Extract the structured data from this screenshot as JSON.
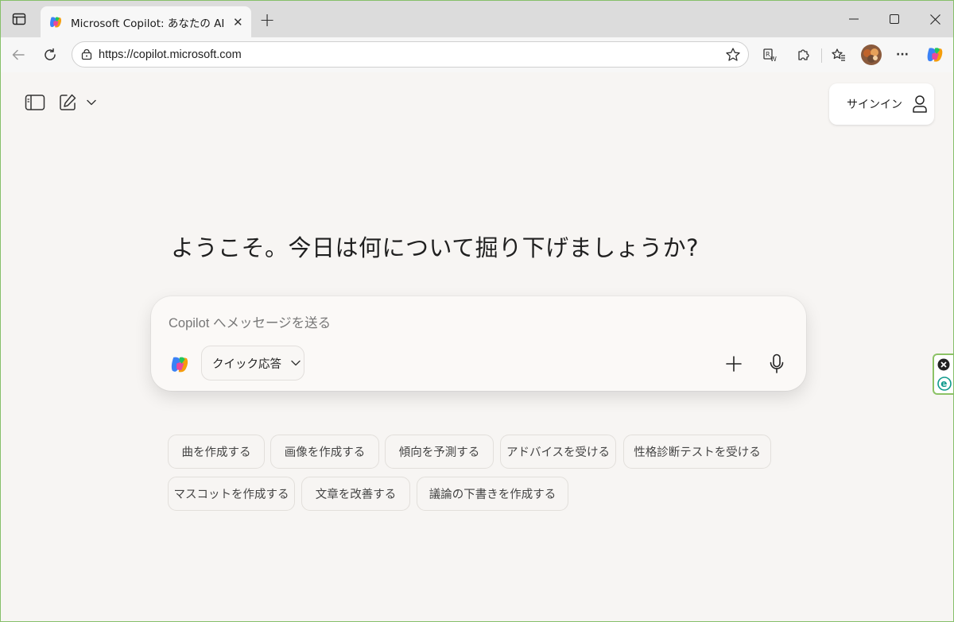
{
  "browser": {
    "tab_title": "Microsoft Copilot: あなたの AI アシスタント",
    "url": "https://copilot.microsoft.com",
    "new_tab_symbol": "+",
    "more_symbol": "···"
  },
  "header": {
    "signin_label": "サインイン"
  },
  "main": {
    "headline": "ようこそ。今日は何について掘り下げましょうか?",
    "composer_placeholder": "Copilot へメッセージを送る",
    "mode_label": "クイック応答"
  },
  "suggestions": [
    "曲を作成する",
    "画像を作成する",
    "傾向を予測する",
    "アドバイスを受ける",
    "性格診断テストを受ける",
    "マスコットを作成する",
    "文章を改善する",
    "議論の下書きを作成する"
  ],
  "colors": {
    "page_bg": "#f7f5f3",
    "tabstrip_bg": "#dcdcdc",
    "window_border": "#86c06a"
  }
}
